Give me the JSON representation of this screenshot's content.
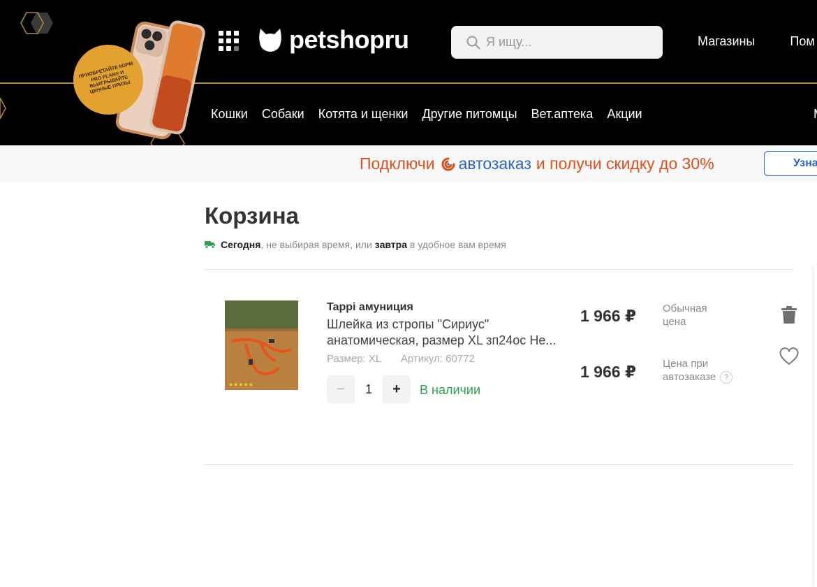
{
  "header": {
    "promo_text": "ПРИОБРЕТАЙТЕ КОРМ PRO PLAN® И ВЫИГРЫВАЙТЕ ЦЕННЫЕ ПРИЗЫ",
    "logo_text": "petshopru",
    "search_placeholder": "Я ищу...",
    "top_links": [
      "Магазины",
      "Пом"
    ],
    "categories": [
      "Кошки",
      "Собаки",
      "Котята и щенки",
      "Другие питомцы",
      "Вет.аптека",
      "Акции"
    ],
    "category_cut": "М"
  },
  "banner": {
    "text_1": "Подключи",
    "text_2": "автозаказ",
    "text_3": "и получи скидку до 30%",
    "button_label": "Узна"
  },
  "cart": {
    "title": "Корзина",
    "delivery": {
      "today": "Сегодня",
      "middle": ", не выбирая время, или",
      "tomorrow": "завтра",
      "end": "в удобное вам время"
    },
    "item": {
      "brand": "Tappi амуниция",
      "name_line1": "Шлейка из стропы \"Сириус\"",
      "name_line2": "анатомическая, размер XL зп24ос Не...",
      "size": "Размер: XL",
      "article": "Артикул: 60772",
      "quantity": "1",
      "minus": "−",
      "plus": "+",
      "stock": "В наличии",
      "regular_price": "1 966 ₽",
      "regular_label_1": "Обычная",
      "regular_label_2": "цена",
      "auto_price": "1 966 ₽",
      "auto_label_1": "Цена при",
      "auto_label_2": "автозаказе",
      "help": "?"
    }
  },
  "colors": {
    "header_bg": "#000000",
    "gold": "#b38a3a",
    "accent_orange": "#e0501a",
    "accent_blue": "#2a63c4",
    "in_stock_green": "#2fa04d"
  }
}
